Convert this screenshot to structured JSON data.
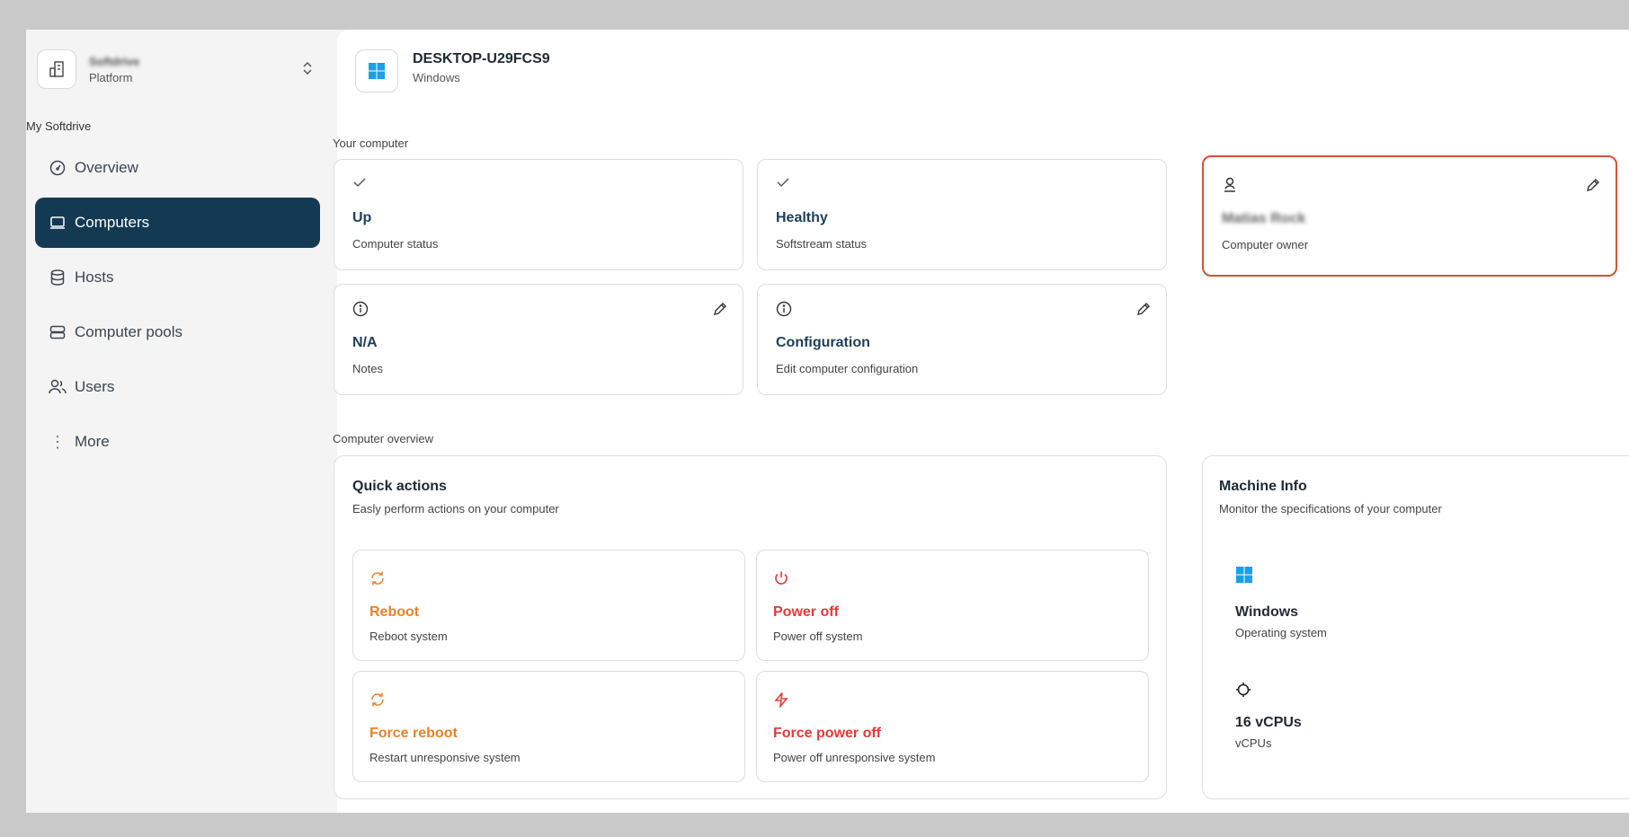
{
  "sidebar": {
    "org_name": "Softdrive",
    "org_sub": "Platform",
    "section_label": "My Softdrive",
    "items": [
      {
        "label": "Overview",
        "icon": "gauge-icon"
      },
      {
        "label": "Computers",
        "icon": "laptop-icon"
      },
      {
        "label": "Hosts",
        "icon": "database-icon"
      },
      {
        "label": "Computer pools",
        "icon": "server-icon"
      },
      {
        "label": "Users",
        "icon": "users-icon"
      },
      {
        "label": "More",
        "icon": "more-vertical-icon"
      }
    ],
    "active_item": "Computers"
  },
  "device": {
    "name": "DESKTOP-U29FCS9",
    "os": "Windows"
  },
  "your_computer": {
    "label": "Your computer",
    "cards": [
      {
        "title": "Up",
        "sub": "Computer status",
        "icon": "check-icon"
      },
      {
        "title": "Healthy",
        "sub": "Softstream status",
        "icon": "check-icon"
      },
      {
        "title": "Matias Rock",
        "sub": "Computer owner",
        "icon": "user-icon",
        "editable": true
      },
      {
        "title": "N/A",
        "sub": "Notes",
        "icon": "info-icon",
        "editable": true
      },
      {
        "title": "Configuration",
        "sub": "Edit computer configuration",
        "icon": "info-icon",
        "editable": true
      }
    ]
  },
  "overview": {
    "label": "Computer overview",
    "quick_actions": {
      "title": "Quick actions",
      "sub": "Easly perform actions on your computer",
      "actions": [
        {
          "title": "Reboot",
          "sub": "Reboot system",
          "icon": "refresh-icon"
        },
        {
          "title": "Power off",
          "sub": "Power off system",
          "icon": "power-icon"
        },
        {
          "title": "Force reboot",
          "sub": "Restart unresponsive system",
          "icon": "refresh-icon"
        },
        {
          "title": "Force power off",
          "sub": "Power off unresponsive system",
          "icon": "zap-icon"
        }
      ]
    },
    "machine_info": {
      "title": "Machine Info",
      "sub": "Monitor the specifications of your computer",
      "specs": [
        {
          "title": "Windows",
          "sub": "Operating system",
          "icon": "windows-logo-icon"
        },
        {
          "title": "16 vCPUs",
          "sub": "vCPUs",
          "icon": "cpu-icon"
        }
      ]
    }
  },
  "colors": {
    "accent": "#133a52",
    "orange": "#e8822a",
    "red": "#e23a3a",
    "highlight": "#d8503b",
    "windows_blue": "#1aa0e8"
  }
}
